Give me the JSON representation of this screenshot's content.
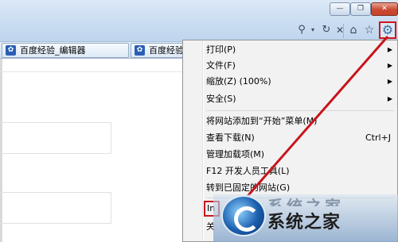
{
  "window": {
    "minimize_glyph": "—",
    "maximize_glyph": "❐",
    "close_glyph": "✕"
  },
  "toolbar": {
    "search_icon": "search-icon",
    "refresh_icon": "refresh-icon",
    "stop_icon": "stop-icon",
    "home_icon": "home-icon",
    "favorites_icon": "star-icon",
    "tools_icon": "gear-icon"
  },
  "favorites": [
    {
      "label": "百度经验_编辑器"
    },
    {
      "label": "百度经验"
    }
  ],
  "menu": {
    "items": [
      {
        "label": "打印(P)",
        "has_submenu": true
      },
      {
        "label": "文件(F)",
        "has_submenu": true
      },
      {
        "label": "缩放(Z) (100%)",
        "has_submenu": true
      },
      {
        "label": "安全(S)",
        "has_submenu": true
      },
      {
        "label": "将网站添加到“开始”菜单(M)"
      },
      {
        "label": "查看下载(N)",
        "shortcut": "Ctrl+J"
      },
      {
        "label": "管理加载项(M)"
      },
      {
        "label": "F12 开发人员工具(L)"
      },
      {
        "label": "转到已固定的网站(G)"
      },
      {
        "label": "In"
      },
      {
        "label": "关"
      }
    ]
  },
  "watermark": {
    "text": "系统之家",
    "text_top": "系统之家"
  },
  "annotation_color": "#c8141b"
}
